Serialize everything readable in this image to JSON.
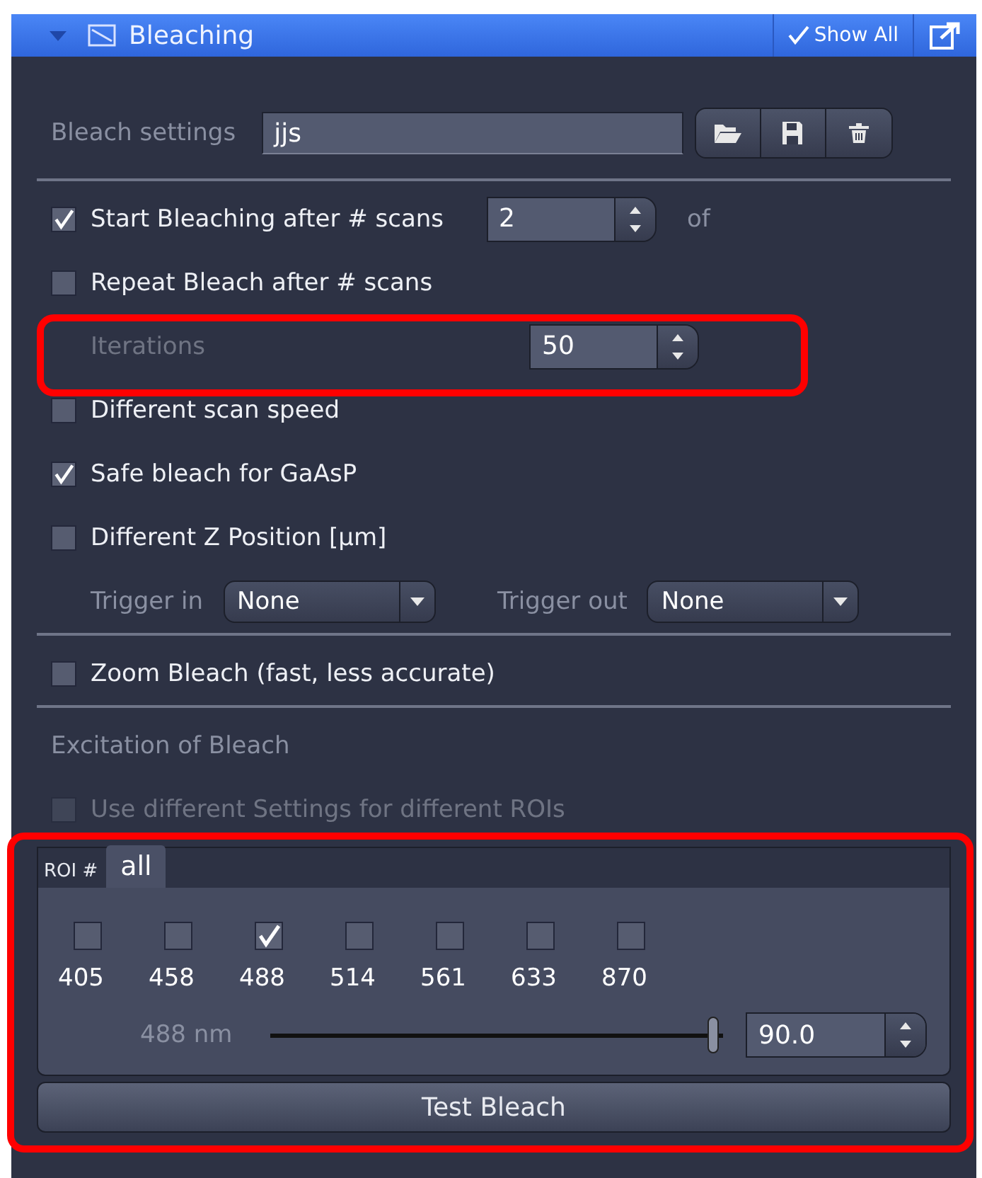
{
  "panel": {
    "title": "Bleaching",
    "expanded": true,
    "show_all": {
      "label": "Show All",
      "checked": true
    }
  },
  "bleach_settings": {
    "label": "Bleach settings",
    "value": "jjs"
  },
  "options": [
    {
      "kind": "checkbox",
      "label": "Start Bleaching after # scans",
      "checked": true,
      "spin": "2",
      "suffix": "of"
    },
    {
      "kind": "checkbox",
      "label": "Repeat Bleach after # scans",
      "checked": false
    },
    {
      "kind": "field",
      "label": "Iterations",
      "spin": "50",
      "disabled": true,
      "highlighted": true
    },
    {
      "kind": "checkbox",
      "label": "Different scan speed",
      "checked": false
    },
    {
      "kind": "checkbox",
      "label": "Safe bleach for GaAsP",
      "checked": true
    },
    {
      "kind": "checkbox",
      "label": "Different Z Position [µm]",
      "checked": false
    },
    {
      "kind": "triggers",
      "triggers": [
        {
          "label": "Trigger in",
          "value": "None"
        },
        {
          "label": "Trigger out",
          "value": "None"
        }
      ]
    }
  ],
  "zoom_bleach": {
    "label": "Zoom Bleach (fast, less accurate)",
    "checked": false
  },
  "excitation": {
    "title": "Excitation of Bleach",
    "per_roi": {
      "label": "Use different Settings for different ROIs",
      "checked": false,
      "disabled": true
    },
    "roi_label": "ROI #",
    "tabs": [
      {
        "label": "all",
        "selected": true
      }
    ],
    "lines": [
      {
        "label": "405",
        "checked": false
      },
      {
        "label": "458",
        "checked": false
      },
      {
        "label": "488",
        "checked": true
      },
      {
        "label": "514",
        "checked": false
      },
      {
        "label": "561",
        "checked": false
      },
      {
        "label": "633",
        "checked": false
      },
      {
        "label": "870",
        "checked": false
      }
    ],
    "slider": {
      "label": "488 nm",
      "level": 0.97,
      "value": "90.0"
    },
    "highlighted": true
  },
  "test_button": "Test Bleach"
}
